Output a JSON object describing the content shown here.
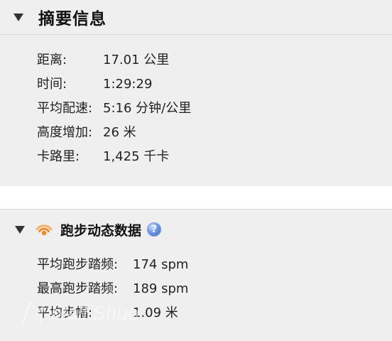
{
  "summary": {
    "title": "摘要信息",
    "rows": [
      {
        "label": "距离:",
        "value": "17.01 公里"
      },
      {
        "label": "时间:",
        "value": "1:29:29"
      },
      {
        "label": "平均配速:",
        "value": "5:16 分钟/公里"
      },
      {
        "label": "高度增加:",
        "value": "26 米"
      },
      {
        "label": "卡路里:",
        "value": "1,425 千卡"
      }
    ]
  },
  "running_dynamics": {
    "title": "跑步动态数据",
    "help_symbol": "?",
    "rows": [
      {
        "label": "平均跑步踏频:",
        "value": "174 spm"
      },
      {
        "label": "最高跑步踏频:",
        "value": "189 spm"
      },
      {
        "label": "平均步幅:",
        "value": "1.09 米"
      }
    ]
  },
  "watermark": {
    "text": "Mall Shuo"
  },
  "colors": {
    "panel_background": "#efefef",
    "page_background": "#ffffff",
    "icon_orange": "#f08a24",
    "help_blue": "#5e86d8"
  },
  "icons": {
    "summary_toggle": "triangle-down-icon",
    "running_toggle": "triangle-down-icon",
    "running_section": "rss-signal-icon",
    "help": "help-icon"
  }
}
